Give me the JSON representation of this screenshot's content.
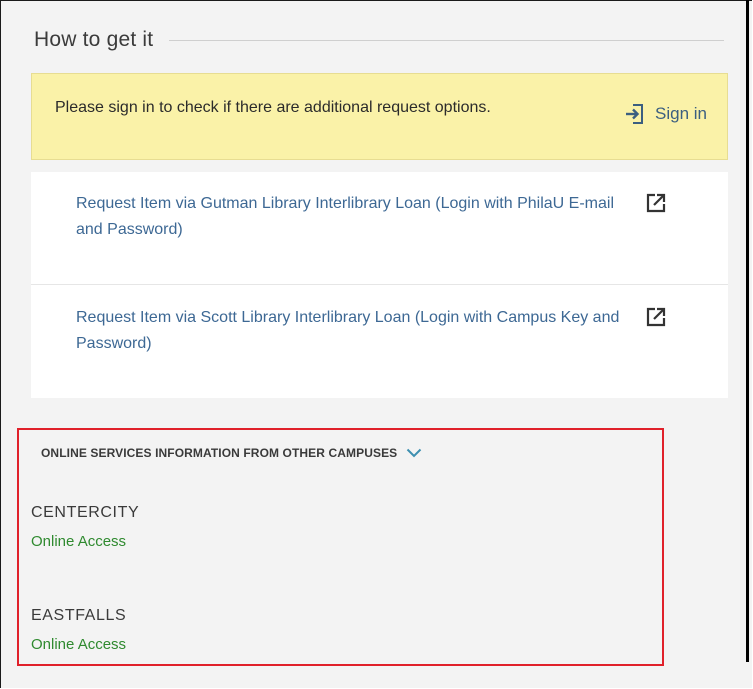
{
  "section": {
    "title": "How to get it"
  },
  "signin_notice": {
    "message": "Please sign in to check if there are additional request options.",
    "button_label": "Sign in"
  },
  "request_links": [
    {
      "label": "Request Item via Gutman Library Interlibrary Loan (Login with PhilaU E-mail and Password)"
    },
    {
      "label": "Request Item via Scott Library Interlibrary Loan (Login with Campus Key and Password)"
    }
  ],
  "other_campuses": {
    "header": "ONLINE SERVICES INFORMATION FROM OTHER CAMPUSES",
    "campuses": [
      {
        "name": "CENTERCITY",
        "link": "Online Access"
      },
      {
        "name": "EASTFALLS",
        "link": "Online Access"
      }
    ]
  },
  "colors": {
    "link_blue": "#3d6894",
    "online_green": "#2f8a2f",
    "notice_yellow": "#faf2a8",
    "highlight_red": "#e0202a"
  },
  "icons": {
    "signin": "sign-in-icon",
    "external": "external-link-icon",
    "expand": "chevron-down-icon"
  }
}
